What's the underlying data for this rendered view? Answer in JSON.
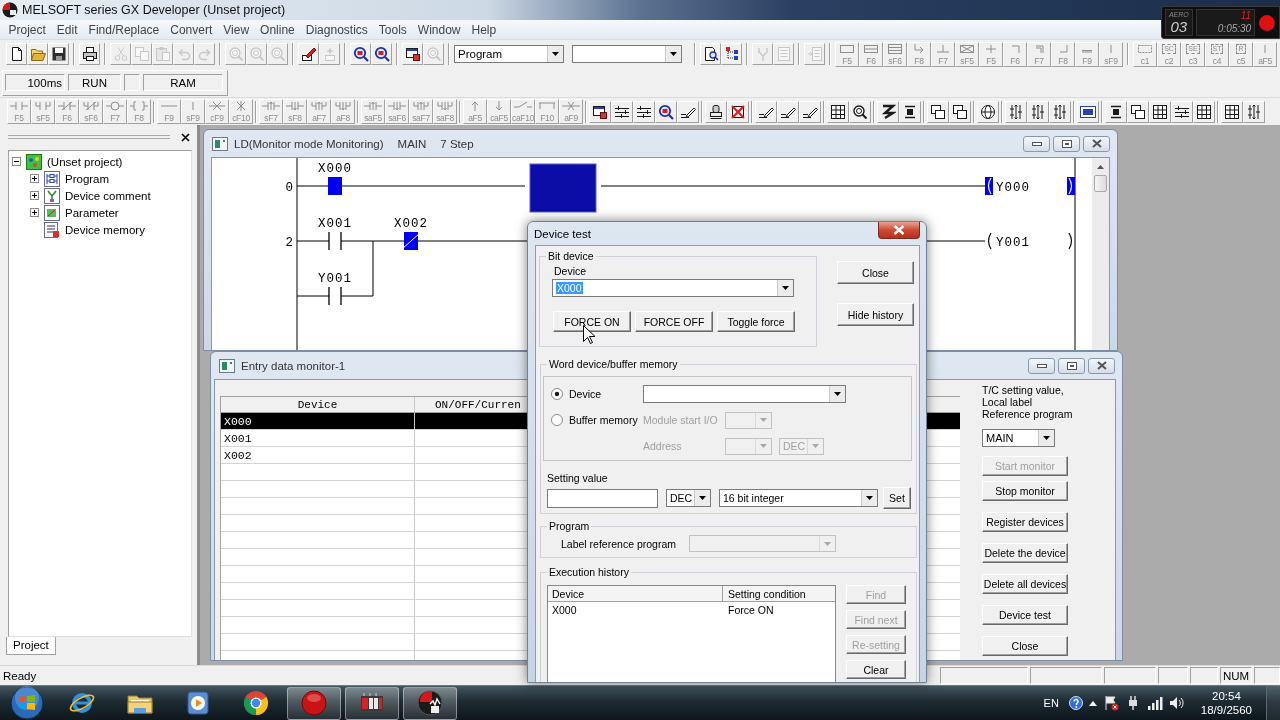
{
  "window": {
    "title": "MELSOFT series GX Developer (Unset project)"
  },
  "recorder": {
    "brand": "AERO",
    "count": "03",
    "fps": "11",
    "elapsed": "0:05:30"
  },
  "menu": [
    "Project",
    "Edit",
    "Find/Replace",
    "Convert",
    "View",
    "Online",
    "Diagnostics",
    "Tools",
    "Window",
    "Help"
  ],
  "toolbar_1": [
    {
      "kind": "new",
      "disabled": false
    },
    {
      "kind": "open",
      "disabled": false
    },
    {
      "kind": "save",
      "disabled": false
    },
    {
      "kind": "separator"
    },
    {
      "kind": "print",
      "disabled": false
    },
    {
      "kind": "separator"
    },
    {
      "kind": "cut",
      "disabled": true
    },
    {
      "kind": "copy",
      "disabled": true
    },
    {
      "kind": "paste",
      "disabled": true
    },
    {
      "kind": "undo",
      "disabled": true
    },
    {
      "kind": "redo",
      "disabled": true
    },
    {
      "kind": "separator"
    },
    {
      "kind": "find",
      "disabled": true
    },
    {
      "kind": "find",
      "disabled": true
    },
    {
      "kind": "find",
      "disabled": true
    },
    {
      "kind": "separator"
    },
    {
      "kind": "write",
      "disabled": false
    },
    {
      "kind": "sparkle",
      "disabled": true
    },
    {
      "kind": "separator"
    },
    {
      "kind": "zoom",
      "disabled": false
    },
    {
      "kind": "zoom",
      "disabled": false
    },
    {
      "kind": "separator"
    },
    {
      "kind": "monitor",
      "disabled": false
    },
    {
      "kind": "find",
      "disabled": true
    },
    {
      "kind": "separator"
    },
    {
      "kind": "select",
      "value": "Program"
    },
    {
      "kind": "select"
    },
    {
      "kind": "separator"
    },
    {
      "kind": "doc_zoom",
      "disabled": false
    },
    {
      "kind": "tree",
      "disabled": false
    },
    {
      "kind": "separator"
    },
    {
      "kind": "fork",
      "disabled": true
    },
    {
      "kind": "list",
      "disabled": true
    },
    {
      "kind": "separator"
    },
    {
      "kind": "doc",
      "disabled": true
    },
    {
      "kind": "separator"
    },
    {
      "kind": "key",
      "symbol": {
        "kind": "box"
      },
      "label": "F5",
      "disabled": true
    },
    {
      "kind": "key",
      "symbol": {
        "kind": "box2"
      },
      "label": "F6",
      "disabled": true
    },
    {
      "kind": "key",
      "symbol": {
        "kind": "box3"
      },
      "label": "sF6",
      "disabled": true
    },
    {
      "kind": "key",
      "symbol": {
        "kind": "bend"
      },
      "label": "F8",
      "disabled": true
    },
    {
      "kind": "key",
      "symbol": {
        "kind": "tee"
      },
      "label": "F7",
      "disabled": true
    },
    {
      "kind": "key",
      "symbol": {
        "kind": "box_x"
      },
      "label": "sF5",
      "disabled": true
    },
    {
      "kind": "key",
      "symbol": {
        "kind": "plus"
      },
      "label": "F5",
      "disabled": true
    },
    {
      "kind": "key",
      "symbol": {
        "kind": "corner"
      },
      "label": "F6",
      "disabled": true
    },
    {
      "kind": "key",
      "symbol": {
        "kind": "corner2"
      },
      "label": "F7",
      "disabled": true
    },
    {
      "kind": "key",
      "symbol": {
        "kind": "corner_up"
      },
      "label": "F8",
      "disabled": true
    },
    {
      "kind": "key",
      "symbol": {
        "kind": "bar"
      },
      "label": "F9",
      "disabled": true
    },
    {
      "kind": "key",
      "symbol": {
        "kind": "vline"
      },
      "label": "sF9",
      "disabled": true
    },
    {
      "kind": "separator"
    },
    {
      "kind": "key",
      "symbol": {
        "kind": "dashed"
      },
      "label": "c1",
      "disabled": true
    },
    {
      "kind": "key",
      "symbol": {
        "kind": "tag",
        "text": "SC"
      },
      "label": "c2",
      "disabled": true
    },
    {
      "kind": "key",
      "symbol": {
        "kind": "tag",
        "text": "SE"
      },
      "label": "c3",
      "disabled": true
    },
    {
      "kind": "key",
      "symbol": {
        "kind": "tag",
        "text": "ST"
      },
      "label": "c4",
      "disabled": true
    },
    {
      "kind": "key",
      "symbol": {
        "kind": "tag",
        "text": "R"
      },
      "label": "c5",
      "disabled": true
    },
    {
      "kind": "key",
      "symbol": {
        "kind": "vline"
      },
      "label": "aF5",
      "disabled": true
    }
  ],
  "plc_status": [
    {
      "kind": "text",
      "text": "100ms"
    },
    {
      "kind": "text",
      "text": "RUN"
    },
    {
      "kind": "blank"
    },
    {
      "kind": "text",
      "text": "RAM"
    }
  ],
  "toolbar_2": [
    {
      "kind": "key",
      "symbol": {
        "kind": "contact"
      },
      "label": "F5",
      "disabled": true
    },
    {
      "kind": "key",
      "symbol": {
        "kind": "contact_par"
      },
      "label": "sF5",
      "disabled": true
    },
    {
      "kind": "key",
      "symbol": {
        "kind": "contact_nc"
      },
      "label": "F6",
      "disabled": true
    },
    {
      "kind": "key",
      "symbol": {
        "kind": "contact_nc_par"
      },
      "label": "sF6",
      "disabled": true
    },
    {
      "kind": "key",
      "symbol": {
        "kind": "coil"
      },
      "label": "F7",
      "disabled": true
    },
    {
      "kind": "key",
      "symbol": {
        "kind": "func"
      },
      "label": "F8",
      "disabled": true
    },
    {
      "kind": "separator"
    },
    {
      "kind": "key",
      "symbol": {
        "kind": "hline"
      },
      "label": "F9",
      "disabled": true
    },
    {
      "kind": "key",
      "symbol": {
        "kind": "vline"
      },
      "label": "sF9",
      "disabled": true
    },
    {
      "kind": "key",
      "symbol": {
        "kind": "hline_del"
      },
      "label": "cF9",
      "disabled": true
    },
    {
      "kind": "key",
      "symbol": {
        "kind": "vline_del"
      },
      "label": "cF10",
      "disabled": true
    },
    {
      "kind": "separator"
    },
    {
      "kind": "key",
      "symbol": {
        "kind": "rise"
      },
      "label": "sF7",
      "disabled": true
    },
    {
      "kind": "key",
      "symbol": {
        "kind": "fall"
      },
      "label": "sF8",
      "disabled": true
    },
    {
      "kind": "key",
      "symbol": {
        "kind": "rise_par"
      },
      "label": "aF7",
      "disabled": true
    },
    {
      "kind": "key",
      "symbol": {
        "kind": "fall_par"
      },
      "label": "aF8",
      "disabled": true
    },
    {
      "kind": "separator"
    },
    {
      "kind": "key",
      "symbol": {
        "kind": "rise"
      },
      "label": "saF5",
      "disabled": true
    },
    {
      "kind": "key",
      "symbol": {
        "kind": "fall"
      },
      "label": "saF6",
      "disabled": true
    },
    {
      "kind": "key",
      "symbol": {
        "kind": "rise_par"
      },
      "label": "saF7",
      "disabled": true
    },
    {
      "kind": "key",
      "symbol": {
        "kind": "fall_par"
      },
      "label": "saF8",
      "disabled": true
    },
    {
      "kind": "separator"
    },
    {
      "kind": "key",
      "symbol": {
        "kind": "arrow_up"
      },
      "label": "aF5",
      "disabled": true
    },
    {
      "kind": "key",
      "symbol": {
        "kind": "arrow_down"
      },
      "label": "caF5",
      "disabled": true
    },
    {
      "kind": "key",
      "symbol": {
        "kind": "slash"
      },
      "label": "caF10",
      "disabled": true
    },
    {
      "kind": "key",
      "symbol": {
        "kind": "line_box"
      },
      "label": "F10",
      "disabled": true
    },
    {
      "kind": "key",
      "symbol": {
        "kind": "line_x"
      },
      "label": "aF9",
      "disabled": true
    },
    {
      "kind": "separator"
    },
    {
      "kind": "monitor",
      "disabled": false
    },
    {
      "kind": "lines",
      "disabled": false
    },
    {
      "kind": "lines",
      "disabled": false
    },
    {
      "kind": "zoom",
      "disabled": false
    },
    {
      "kind": "pencil",
      "disabled": false
    },
    {
      "kind": "separator"
    },
    {
      "kind": "stamp",
      "disabled": false
    },
    {
      "kind": "cross",
      "disabled": false
    },
    {
      "kind": "separator"
    },
    {
      "kind": "pencil",
      "disabled": false
    },
    {
      "kind": "pencil",
      "disabled": false
    },
    {
      "kind": "pencil",
      "disabled": false
    },
    {
      "kind": "separator"
    },
    {
      "kind": "grid",
      "disabled": false
    },
    {
      "kind": "find",
      "disabled": false
    },
    {
      "kind": "separator"
    },
    {
      "kind": "zigzag",
      "disabled": false
    },
    {
      "kind": "bar",
      "disabled": false
    },
    {
      "kind": "separator"
    },
    {
      "kind": "windows",
      "disabled": false
    },
    {
      "kind": "windows",
      "disabled": false
    },
    {
      "kind": "separator"
    },
    {
      "kind": "globe",
      "disabled": false
    },
    {
      "kind": "separator"
    },
    {
      "kind": "arrows",
      "disabled": false
    },
    {
      "kind": "arrows",
      "disabled": false
    },
    {
      "kind": "arrows",
      "disabled": false
    },
    {
      "kind": "separator"
    },
    {
      "kind": "screen",
      "disabled": false
    },
    {
      "kind": "separator"
    },
    {
      "kind": "bar",
      "disabled": false
    },
    {
      "kind": "windows",
      "disabled": false
    },
    {
      "kind": "grid",
      "disabled": false
    },
    {
      "kind": "lines",
      "disabled": false
    },
    {
      "kind": "grid",
      "disabled": false
    },
    {
      "kind": "separator"
    },
    {
      "kind": "grid",
      "disabled": false
    },
    {
      "kind": "arrows",
      "disabled": false
    }
  ],
  "project_panel": {
    "tree": {
      "label": "(Unset project)",
      "kind": "project",
      "expanded": true,
      "children": [
        {
          "label": "Program",
          "kind": "program",
          "expanded": false
        },
        {
          "label": "Device comment",
          "kind": "comment",
          "expanded": false
        },
        {
          "label": "Parameter",
          "kind": "parameter",
          "expanded": false
        },
        {
          "label": "Device memory",
          "kind": "memory"
        }
      ]
    },
    "tabs": [
      {
        "label": "Project",
        "selected": true
      }
    ]
  },
  "ladder_window": {
    "title_parts": [
      "LD(Monitor mode Monitoring)",
      "MAIN",
      "7 Step"
    ],
    "rungs": [
      {
        "step": "0",
        "cells": [
          {
            "kind": "contact",
            "label": "X000",
            "on": true
          },
          {
            "kind": "wire"
          },
          {
            "kind": "wire"
          },
          {
            "kind": "cursor"
          },
          {
            "kind": "wire"
          },
          {
            "kind": "wire"
          },
          {
            "kind": "wire"
          },
          {
            "kind": "wire"
          },
          {
            "kind": "wire"
          }
        ],
        "coil": {
          "label": "Y000",
          "on": true
        }
      },
      {
        "step": "2",
        "cells": [
          {
            "kind": "contact",
            "label": "X001",
            "on": false
          },
          {
            "kind": "contact_nc",
            "label": "X002",
            "on": true
          },
          {
            "kind": "wire"
          },
          {
            "kind": "wire"
          },
          {
            "kind": "wire"
          },
          {
            "kind": "wire"
          },
          {
            "kind": "wire"
          },
          {
            "kind": "wire"
          },
          {
            "kind": "wire"
          }
        ],
        "branch": [
          {
            "kind": "contact",
            "label": "Y001",
            "on": false
          }
        ],
        "coil": {
          "label": "Y001",
          "on": false
        }
      }
    ]
  },
  "monitor_window": {
    "title": "Entry data monitor-1",
    "columns": [
      "Device",
      "ON/OFF/Curren"
    ],
    "rows": [
      {
        "device": "X000",
        "selected": true
      },
      {
        "device": "X001",
        "selected": false
      },
      {
        "device": "X002",
        "selected": false
      }
    ],
    "note": "T/C setting value,\nLocal label\nReference program",
    "program": "MAIN",
    "buttons": [
      {
        "label": "Start monitor",
        "disabled": true
      },
      {
        "label": "Stop monitor",
        "disabled": false
      },
      {
        "label": "Register devices",
        "disabled": false
      },
      {
        "label": "Delete the device",
        "disabled": false
      },
      {
        "label": "Delete all devices",
        "disabled": false
      },
      {
        "label": "Device test",
        "disabled": false
      },
      {
        "label": "Close",
        "disabled": false
      }
    ]
  },
  "device_test": {
    "title": "Device test",
    "bit_device": {
      "legend": "Bit device",
      "device_label": "Device",
      "device_value": "X000",
      "value_highlighted": true,
      "buttons": [
        "FORCE ON",
        "FORCE OFF",
        "Toggle force"
      ]
    },
    "side_buttons": [
      "Close",
      "Hide history"
    ],
    "word_device": {
      "legend": "Word device/buffer memory",
      "options": [
        {
          "label": "Device",
          "selected": true
        },
        {
          "label": "Buffer memory",
          "selected": false
        }
      ],
      "module_start": {
        "label": "Module start I/O",
        "disabled": true
      },
      "address": {
        "label": "Address",
        "format": "DEC",
        "disabled": true
      }
    },
    "setting_value": {
      "label": "Setting value",
      "format": "DEC",
      "data_type": "16 bit integer",
      "button": "Set"
    },
    "program": {
      "legend": "Program",
      "label": "Label reference program",
      "disabled": true
    },
    "history": {
      "legend": "Execution history",
      "columns": [
        "Device",
        "Setting condition"
      ],
      "rows": [
        {
          "device": "X000",
          "condition": "Force ON"
        }
      ],
      "buttons": [
        {
          "label": "Find",
          "disabled": true
        },
        {
          "label": "Find next",
          "disabled": true
        },
        {
          "label": "Re-setting",
          "disabled": true
        },
        {
          "label": "Clear",
          "disabled": false
        }
      ]
    }
  },
  "status_bar": {
    "message": "Ready",
    "indicators": [
      "NUM"
    ]
  },
  "taskbar": {
    "items": [
      {
        "kind": "browser",
        "running": false
      },
      {
        "kind": "folder",
        "running": false
      },
      {
        "kind": "media",
        "running": false
      },
      {
        "kind": "chrome",
        "running": false
      },
      {
        "kind": "record",
        "running": true
      },
      {
        "kind": "panel",
        "running": true
      },
      {
        "kind": "round_logo",
        "running": true
      }
    ],
    "tray": {
      "language": "EN",
      "time": "20:54",
      "date": "18/9/2560"
    }
  }
}
